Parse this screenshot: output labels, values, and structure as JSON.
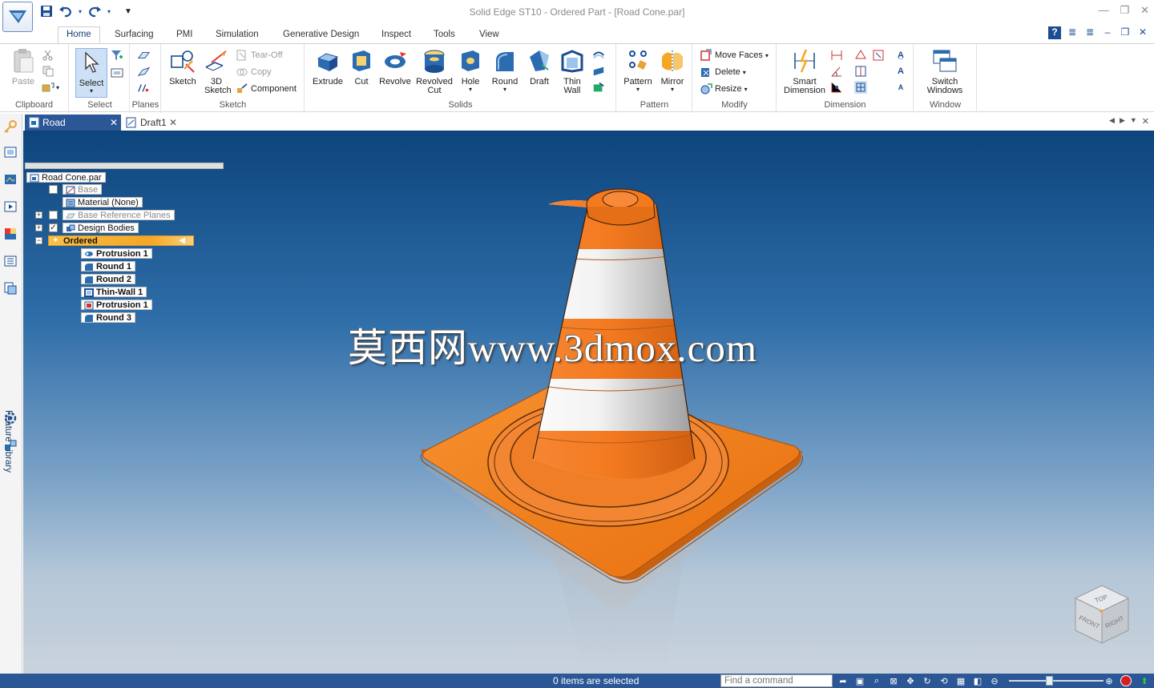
{
  "window": {
    "title": "Solid Edge ST10 - Ordered Part - [Road Cone.par]",
    "controls": [
      "minimize-icon",
      "restore-icon",
      "close-icon"
    ]
  },
  "qat": {
    "icons": [
      "save-icon",
      "undo-icon",
      "redo-icon",
      "customize-icon"
    ]
  },
  "ribbon_tabs": [
    "Home",
    "Surfacing",
    "PMI",
    "Simulation",
    "Generative Design",
    "Inspect",
    "Tools",
    "View"
  ],
  "active_tab": "Home",
  "ribbon": {
    "clipboard": {
      "label": "Clipboard",
      "paste": "Paste"
    },
    "select": {
      "label": "Select",
      "select": "Select"
    },
    "planes": {
      "label": "Planes"
    },
    "sketch": {
      "label": "Sketch",
      "sketch": "Sketch",
      "sketch3d": "3D Sketch",
      "tearoff": "Tear-Off",
      "copy": "Copy",
      "component": "Component"
    },
    "solids": {
      "label": "Solids",
      "extrude": "Extrude",
      "cut": "Cut",
      "revolve": "Revolve",
      "revolved_cut": "Revolved Cut",
      "hole": "Hole",
      "round": "Round",
      "draft": "Draft",
      "thin_wall": "Thin Wall"
    },
    "pattern": {
      "label": "Pattern",
      "pattern": "Pattern",
      "mirror": "Mirror"
    },
    "modify": {
      "label": "Modify",
      "move_faces": "Move Faces",
      "delete": "Delete",
      "resize": "Resize"
    },
    "dimension": {
      "label": "Dimension",
      "smart_dimension": "Smart Dimension"
    },
    "window": {
      "label": "Window",
      "switch_windows": "Switch Windows"
    }
  },
  "doc_tabs": [
    {
      "label": "Road Cone.par",
      "active": true
    },
    {
      "label": "Draft1",
      "active": false
    }
  ],
  "left_dock": {
    "feature_library": "Feature Library"
  },
  "pathfinder": {
    "root": "Road Cone.par",
    "base": "Base",
    "material": "Material (None)",
    "base_reference_planes": "Base Reference Planes",
    "design_bodies": "Design Bodies",
    "ordered": "Ordered",
    "features": [
      "Protrusion 1",
      "Round 1",
      "Round 2",
      "Thin-Wall 1",
      "Protrusion 1",
      "Round 3"
    ]
  },
  "watermark": "莫西网www.3dmox.com",
  "viewcube": {
    "top": "TOP",
    "front": "FRONT",
    "right": "RIGHT"
  },
  "status": {
    "selection": "0 items are selected",
    "find_placeholder": "Find a command"
  },
  "colors": {
    "accent": "#2b5797",
    "cone_orange": "#f47a20",
    "cone_white": "#e8e8e8",
    "ordered_highlight": "#f5a623"
  }
}
